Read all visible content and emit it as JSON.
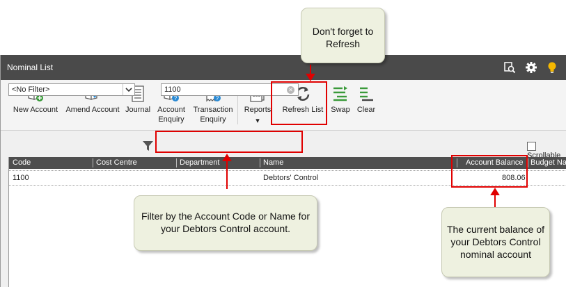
{
  "window": {
    "title": "Nominal List"
  },
  "titlebar_icons": [
    "search-preview-icon",
    "gear-icon",
    "lightbulb-icon"
  ],
  "toolbar": {
    "new_account": "New Account",
    "amend_account": "Amend Account",
    "journal": "Journal",
    "account_enquiry_1": "Account",
    "account_enquiry_2": "Enquiry",
    "transaction_enquiry_1": "Transaction",
    "transaction_enquiry_2": "Enquiry",
    "reports": "Reports",
    "refresh_list": "Refresh List",
    "swap": "Swap",
    "clear": "Clear"
  },
  "filter": {
    "selected": "<No Filter>",
    "search_value": "1100",
    "scrollable_label": "Scrollable"
  },
  "grid": {
    "columns": [
      "Code",
      "Cost Centre",
      "Department",
      "Name",
      "Account Balance",
      "Budget Name"
    ],
    "rows": [
      {
        "code": "1100",
        "cost_centre": "",
        "department": "",
        "name": "Debtors' Control",
        "balance": "808.06"
      }
    ]
  },
  "callouts": {
    "refresh": "Don't forget to Refresh",
    "filter": "Filter by the Account Code or Name for your Debtors Control account.",
    "balance": "The current balance of your Debtors Control nominal account"
  },
  "colors": {
    "titlebar": "#4a4a4a",
    "highlight": "#e00000",
    "callout_bg": "#eef1e0",
    "icon_green": "#3a9a3a",
    "icon_blue": "#2a8ad4"
  }
}
